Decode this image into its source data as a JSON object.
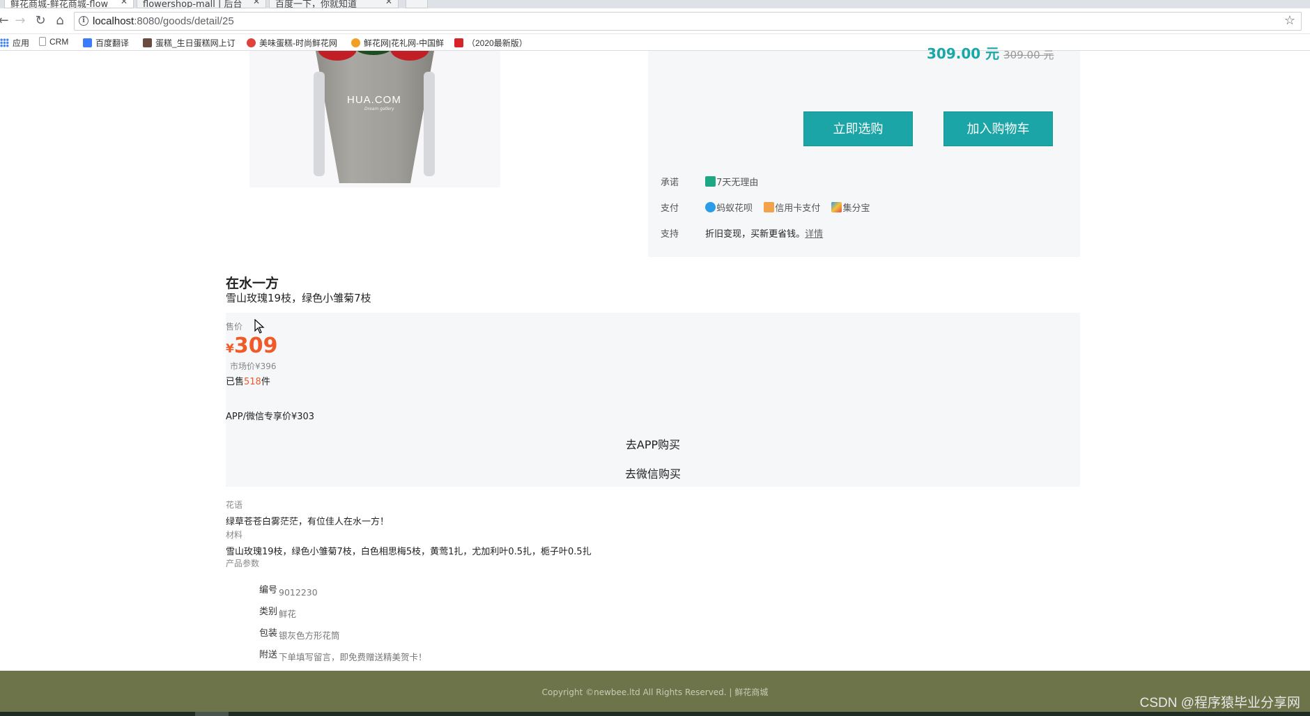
{
  "browser": {
    "tabs": [
      {
        "label": "鲜花商城-鲜花商城-flow"
      },
      {
        "label": "flowershop-mall | 后台"
      },
      {
        "label": "百度一下，你就知道"
      }
    ],
    "url_host": "localhost",
    "url_path": ":8080/goods/detail/25",
    "bookmarks": [
      {
        "label": "应用",
        "icon": "apps-grid-icon",
        "color": "#4285f4"
      },
      {
        "label": "CRM",
        "icon": "page-icon",
        "color": "#bbbbbb"
      },
      {
        "label": "百度翻译",
        "icon": "baidu-translate-icon",
        "color": "#3b7cff"
      },
      {
        "label": "蛋糕_生日蛋糕网上订",
        "icon": "cake-icon",
        "color": "#6b4b3e"
      },
      {
        "label": "美味蛋糕-时尚鲜花网",
        "icon": "rose-icon",
        "color": "#e0413d"
      },
      {
        "label": "鲜花网|花礼网-中国鲜",
        "icon": "flower-icon",
        "color": "#f2a023"
      },
      {
        "label": "（2020最新版）",
        "icon": "c-logo-icon",
        "color": "#d9232a"
      }
    ]
  },
  "buy_panel": {
    "price": "309.00 元",
    "old_price": "309.00 元",
    "buy_now": "立即选购",
    "add_cart": "加入购物车",
    "promise_label": "承诺",
    "promise_value": "7天无理由",
    "pay_label": "支付",
    "pay_methods": [
      "蚂蚁花呗",
      "信用卡支付",
      "集分宝"
    ],
    "support_label": "支持",
    "support_value": "折旧变现，买新更省钱。",
    "support_link": "详情"
  },
  "product": {
    "image_logo": "HUA.COM",
    "image_sub": "Dream gallery",
    "title": "在水一方",
    "subtitle": "雪山玫瑰19枝，绿色小雏菊7枝",
    "price_label": "售价",
    "currency": "¥",
    "price": "309",
    "market_price": "市场价¥396",
    "sold_prefix": "已售",
    "sold_count": "518",
    "sold_suffix": "件",
    "app_price": "APP/微信专享价¥303",
    "go_app": "去APP购买",
    "go_wechat": "去微信购买"
  },
  "details": {
    "language_label": "花语",
    "language_value": "绿草苍苍白雾茫茫，有位佳人在水一方！",
    "material_label": "材料",
    "material_value": "雪山玫瑰19枝，绿色小雏菊7枝，白色相思梅5枝，黄莺1扎，尤加利叶0.5扎，栀子叶0.5扎",
    "params_label": "产品参数",
    "params": [
      {
        "k": "编号",
        "v": "9012230"
      },
      {
        "k": "类别",
        "v": "鲜花"
      },
      {
        "k": "包装",
        "v": "银灰色方形花筒"
      },
      {
        "k": "附送",
        "v": "下单填写留言，即免费赠送精美贺卡！"
      }
    ]
  },
  "footer": {
    "copyright": "Copyright ©newbee.ltd All Rights Reserved.  |",
    "link": "鲜花商城"
  },
  "watermark": "CSDN @程序猿毕业分享网",
  "colors": {
    "accent": "#1ba5a6",
    "price": "#f05a28",
    "footer": "#6d7449"
  }
}
